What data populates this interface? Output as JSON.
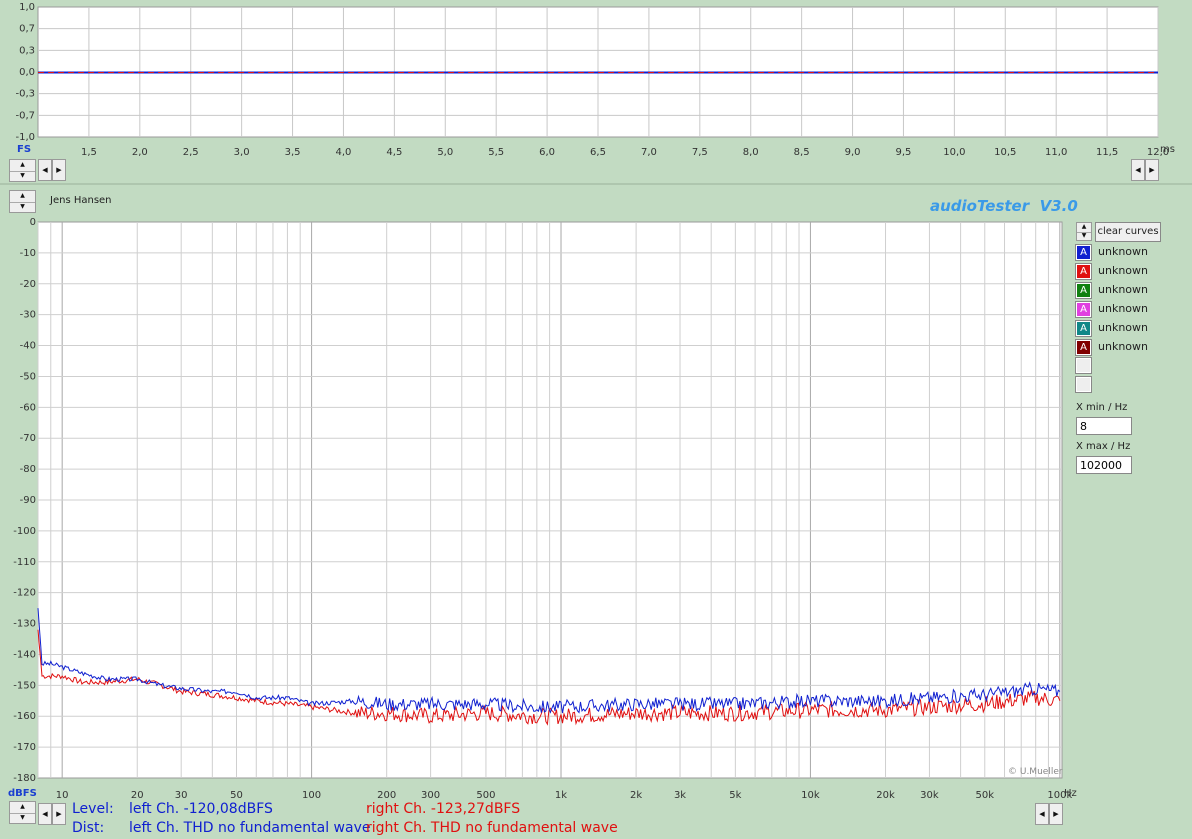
{
  "colors": {
    "blue": "#1020d0",
    "red": "#e01010",
    "green": "#108010",
    "magenta": "#e040e0",
    "teal": "#108888",
    "maroon": "#800000",
    "title": "#3a9ae8"
  },
  "top_axis": {
    "fs_label": "FS",
    "y_ticks": [
      "1,0",
      "0,7",
      "0,3",
      "0,0",
      "-0,3",
      "-0,7",
      "-1,0"
    ],
    "x_ticks": [
      "1,5",
      "2,0",
      "2,5",
      "3,0",
      "3,5",
      "4,0",
      "4,5",
      "5,0",
      "5,5",
      "6,0",
      "6,5",
      "7,0",
      "7,5",
      "8,0",
      "8,5",
      "9,0",
      "9,5",
      "10,0",
      "10,5",
      "11,0",
      "11,5",
      "12,0"
    ],
    "x_unit": "ms"
  },
  "header": {
    "name": "Jens Hansen",
    "app_title": "audioTester  V3.0"
  },
  "bottom_axis": {
    "y_unit": "dBFS",
    "y_ticks": [
      "0",
      "-10",
      "-20",
      "-30",
      "-40",
      "-50",
      "-60",
      "-70",
      "-80",
      "-90",
      "-100",
      "-110",
      "-120",
      "-130",
      "-140",
      "-150",
      "-160",
      "-170",
      "-180"
    ],
    "x_ticks": [
      "10",
      "20",
      "30",
      "50",
      "100",
      "200",
      "300",
      "500",
      "1k",
      "2k",
      "3k",
      "5k",
      "10k",
      "20k",
      "30k",
      "50k",
      "100k"
    ],
    "x_unit": "Hz",
    "copyright": "© U.Mueller"
  },
  "legend": {
    "clear_label": "clear curves",
    "items": [
      {
        "glyph": "A",
        "label": "unknown",
        "color": "#1020d0"
      },
      {
        "glyph": "A",
        "label": "unknown",
        "color": "#e01010"
      },
      {
        "glyph": "A",
        "label": "unknown",
        "color": "#108010"
      },
      {
        "glyph": "A",
        "label": "unknown",
        "color": "#e040e0"
      },
      {
        "glyph": "A",
        "label": "unknown",
        "color": "#108888"
      },
      {
        "glyph": "A",
        "label": "unknown",
        "color": "#800000"
      }
    ],
    "xmin_label": "X min / Hz",
    "xmin_value": "8",
    "xmax_label": "X max / Hz",
    "xmax_value": "102000"
  },
  "status": {
    "level_label": "Level:",
    "level_left": "left Ch. -120,08dBFS",
    "level_right": "right Ch. -123,27dBFS",
    "dist_label": "Dist:",
    "dist_left": "left Ch. THD no fundamental wave",
    "dist_right": "right Ch. THD no fundamental wave"
  },
  "chart_data": [
    {
      "type": "line",
      "xlabel": "ms",
      "ylabel": "FS",
      "xlim": [
        1.0,
        12.0
      ],
      "ylim": [
        -1.0,
        1.0
      ],
      "series": [
        {
          "x": [
            1.0,
            12.0
          ],
          "values": [
            0.0,
            0.0
          ]
        }
      ]
    },
    {
      "type": "line",
      "xlabel": "Hz",
      "ylabel": "dBFS",
      "xscale": "log",
      "xlim": [
        8,
        102000
      ],
      "ylim": [
        -180,
        0
      ],
      "grid": true,
      "series": [
        {
          "color": "#1020d0",
          "x": [
            8,
            8.3,
            9,
            10,
            12,
            15,
            20,
            25,
            30,
            40,
            50,
            60,
            80,
            100,
            150,
            200,
            300,
            500,
            800,
            1000,
            2000,
            3000,
            5000,
            10000,
            20000,
            30000,
            50000,
            80000,
            100000
          ],
          "values": [
            -125,
            -143,
            -143,
            -144,
            -146,
            -148,
            -148,
            -150,
            -151,
            -152,
            -152,
            -154,
            -154,
            -156,
            -155,
            -156,
            -156,
            -156,
            -157,
            -157,
            -156,
            -156,
            -156,
            -155,
            -155,
            -154,
            -153,
            -151,
            -152
          ]
        },
        {
          "color": "#e01010",
          "x": [
            8,
            8.3,
            9,
            10,
            12,
            15,
            20,
            25,
            30,
            40,
            50,
            60,
            80,
            100,
            150,
            200,
            300,
            500,
            800,
            1000,
            2000,
            3000,
            5000,
            10000,
            20000,
            30000,
            50000,
            80000,
            100000
          ],
          "values": [
            -132,
            -147,
            -147,
            -147,
            -149,
            -149,
            -148,
            -150,
            -152,
            -153,
            -154,
            -155,
            -156,
            -157,
            -159,
            -159,
            -160,
            -159,
            -160,
            -160,
            -159,
            -159,
            -159,
            -158,
            -158,
            -157,
            -156,
            -154,
            -155
          ]
        }
      ]
    }
  ]
}
